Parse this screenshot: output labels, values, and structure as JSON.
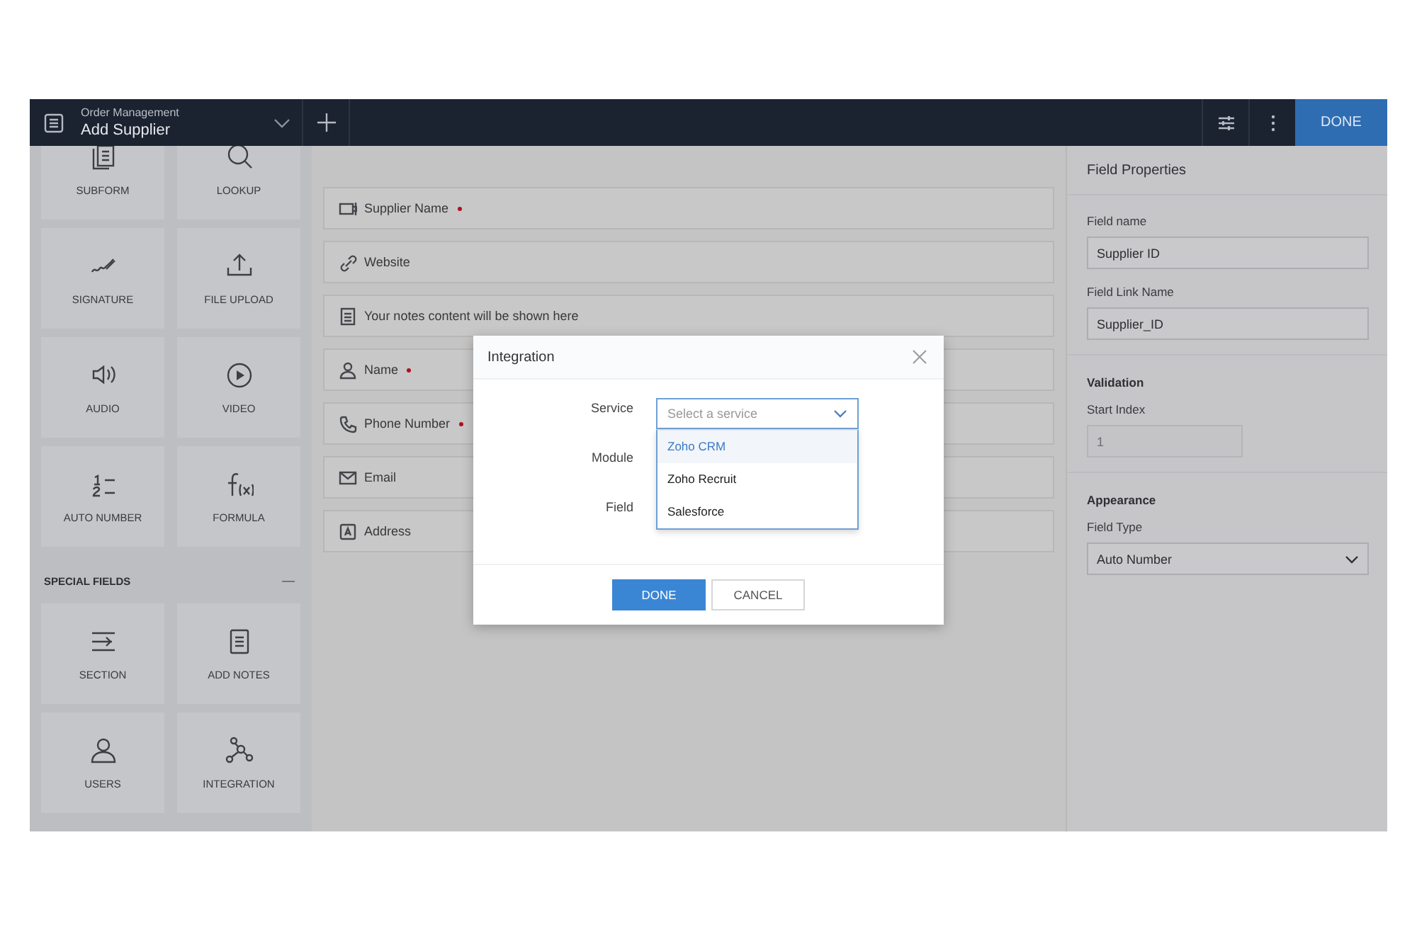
{
  "header": {
    "app": "Order Management",
    "form": "Add Supplier",
    "done": "DONE"
  },
  "palette": [
    {
      "tiles": [
        "SUBFORM",
        "LOOKUP",
        "SIGNATURE",
        "FILE UPLOAD",
        "AUDIO",
        "VIDEO",
        "AUTO NUMBER",
        "FORMULA"
      ]
    },
    {
      "title": "SPECIAL FIELDS",
      "expanded": true,
      "tiles": [
        "SECTION",
        "ADD NOTES",
        "USERS",
        "INTEGRATION"
      ]
    }
  ],
  "form_fields": [
    {
      "label": "Supplier Name",
      "required": true
    },
    {
      "label": "Website",
      "required": false
    },
    {
      "label": "Your notes content will be shown here",
      "required": false
    },
    {
      "label": "Name",
      "required": true
    },
    {
      "label": "Phone Number",
      "required": true
    },
    {
      "label": "Email",
      "required": false
    },
    {
      "label": "Address",
      "required": false
    }
  ],
  "properties": {
    "title": "Field Properties",
    "field_name": {
      "label": "Field name",
      "value": "Supplier ID"
    },
    "link_name": {
      "label": "Field Link Name",
      "value": "Supplier_ID"
    },
    "validation": "Validation",
    "start_index": {
      "label": "Start Index",
      "value": "1",
      "disabled": true
    },
    "appearance": "Appearance",
    "field_type": {
      "label": "Field Type",
      "value": "Auto Number"
    }
  },
  "dialog": {
    "title": "Integration",
    "labels": [
      "Service",
      "Module",
      "Field"
    ],
    "service": {
      "placeholder": "Select a service",
      "expanded": true,
      "options": [
        {
          "label": "Zoho CRM",
          "selected": true
        },
        {
          "label": "Zoho Recruit",
          "selected": false
        },
        {
          "label": "Salesforce",
          "selected": false
        }
      ]
    },
    "buttons": [
      {
        "label": "DONE",
        "kind": "primary"
      },
      {
        "label": "CANCEL",
        "kind": "secondary"
      }
    ]
  }
}
